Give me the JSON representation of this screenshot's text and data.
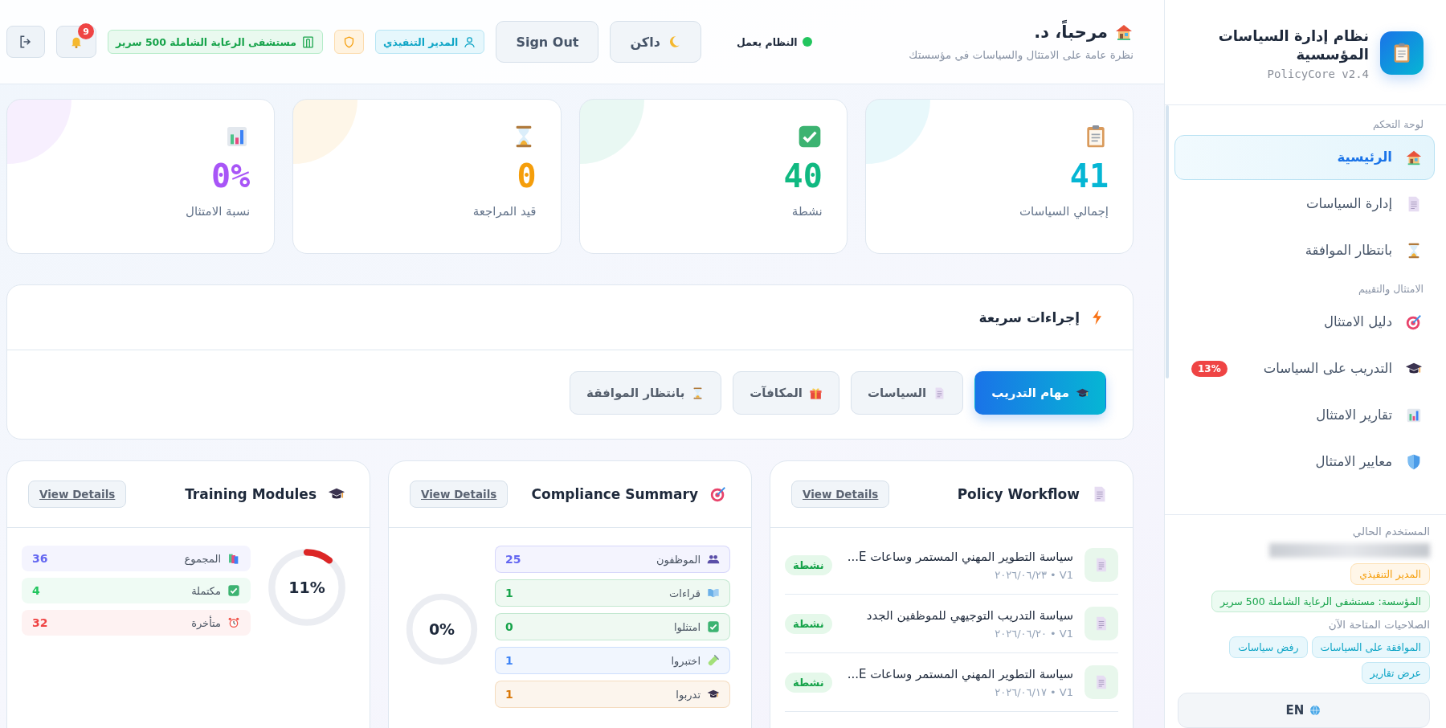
{
  "sidebar": {
    "brand": {
      "title": "نظام إدارة السياسات المؤسسية",
      "version": "PolicyCore v2.4"
    },
    "sections": [
      {
        "label": "لوحة التحكم",
        "items": [
          {
            "label": "الرئيسية",
            "selected": true
          },
          {
            "label": "إدارة السياسات",
            "selected": false
          },
          {
            "label": "بانتظار الموافقة",
            "selected": false
          }
        ]
      },
      {
        "label": "الامتثال والتقييم",
        "items": [
          {
            "label": "دليل الامتثال",
            "selected": false
          },
          {
            "label": "التدريب على السياسات",
            "selected": false,
            "badge": "13%"
          },
          {
            "label": "تقارير الامتثال",
            "selected": false
          },
          {
            "label": "معايير الامتثال",
            "selected": false
          }
        ]
      }
    ],
    "user": {
      "heading": "المستخدم الحالي",
      "role": "المدير التنفيذي",
      "organization": "المؤسسة: مستشفى الرعاية الشاملة 500 سرير",
      "permissions_heading": "الصلاحيات المتاحة الآن",
      "permissions": [
        "الموافقة على السياسات",
        "رفض سياسات",
        "عرض تقارير"
      ]
    },
    "language_button": "EN"
  },
  "header": {
    "title": "مرحباً، د.",
    "subtitle": "نظرة عامة على الامتثال والسياسات في مؤسستك",
    "status": "النظام يعمل",
    "theme_button": "داكن",
    "sign_out": "Sign Out",
    "role_badge": "المدير التنفيذي",
    "org_badge": "مستشفى الرعاية الشاملة 500 سرير",
    "notification_count": "9"
  },
  "stats": [
    {
      "value": "41",
      "label": "إجمالي السياسات",
      "color": "#06b6d4"
    },
    {
      "value": "40",
      "label": "نشطة",
      "color": "#10b981"
    },
    {
      "value": "0",
      "label": "قيد المراجعة",
      "color": "#f59e0b"
    },
    {
      "value": "0%",
      "label": "نسبة الامتثال",
      "color": "#a855f7"
    }
  ],
  "quick_actions": {
    "title": "إجراءات سريعة",
    "buttons": [
      {
        "label": "مهام التدريب",
        "kind": "primary"
      },
      {
        "label": "السياسات",
        "kind": "secondary"
      },
      {
        "label": "المكافآت",
        "kind": "secondary"
      },
      {
        "label": "بانتظار الموافقة",
        "kind": "secondary"
      }
    ]
  },
  "policy_workflow": {
    "title": "Policy Workflow",
    "action": "View Details",
    "items": [
      {
        "title": "سياسة التطوير المهني المستمر وساعات E...",
        "meta": "V1 • ٢٠٢٦/٠٦/٢٣",
        "status": "نشطة"
      },
      {
        "title": "سياسة التدريب التوجيهي للموظفين الجدد",
        "meta": "V1 • ٢٠٢٦/٠٦/٢٠",
        "status": "نشطة"
      },
      {
        "title": "سياسة التطوير المهني المستمر وساعات E...",
        "meta": "V1 • ٢٠٢٦/٠٦/١٧",
        "status": "نشطة"
      }
    ]
  },
  "compliance_summary": {
    "title": "Compliance Summary",
    "action": "View Details",
    "percent": "0%",
    "level": 0,
    "rows": [
      {
        "label": "الموظفون",
        "value": "25",
        "color": "#6366f1"
      },
      {
        "label": "قراءات",
        "value": "1",
        "color": "#16a34a"
      },
      {
        "label": "امتثلوا",
        "value": "0",
        "color": "#16a34a"
      },
      {
        "label": "اختبروا",
        "value": "1",
        "color": "#3b82f6"
      },
      {
        "label": "تدربوا",
        "value": "1",
        "color": "#d97706"
      }
    ]
  },
  "training_modules": {
    "title": "Training Modules",
    "action": "View Details",
    "percent": "11%",
    "level": 0.11,
    "rows": [
      {
        "label": "المجموع",
        "value": "36",
        "color": "#6366f1"
      },
      {
        "label": "مكتملة",
        "value": "4",
        "color": "#22c55e"
      },
      {
        "label": "متأخرة",
        "value": "32",
        "color": "#ef4444"
      }
    ]
  }
}
